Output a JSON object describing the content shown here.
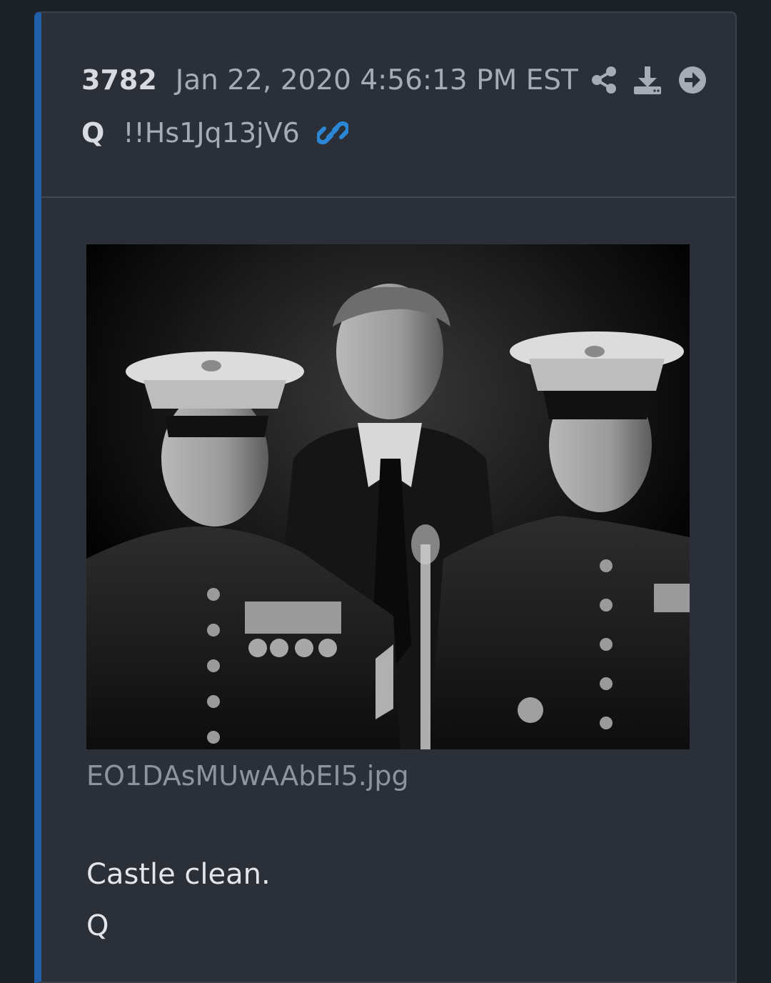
{
  "post": {
    "number": "3782",
    "date": "Jan 22, 2020 4:56:13 PM EST",
    "author": "Q",
    "tripcode": "!!Hs1Jq13jV6",
    "icons": [
      "share-icon",
      "download-icon",
      "arrow-right-circle-icon",
      "link-icon"
    ],
    "attachment": {
      "filename": "EO1DAsMUwAAbEI5.jpg"
    },
    "message_lines": [
      "Castle clean.",
      "Q"
    ]
  },
  "colors": {
    "page_background": "#1d2128",
    "card_background": "#2a2f38",
    "accent_border": "#1f5fa8",
    "link_icon": "#2b86d6"
  }
}
